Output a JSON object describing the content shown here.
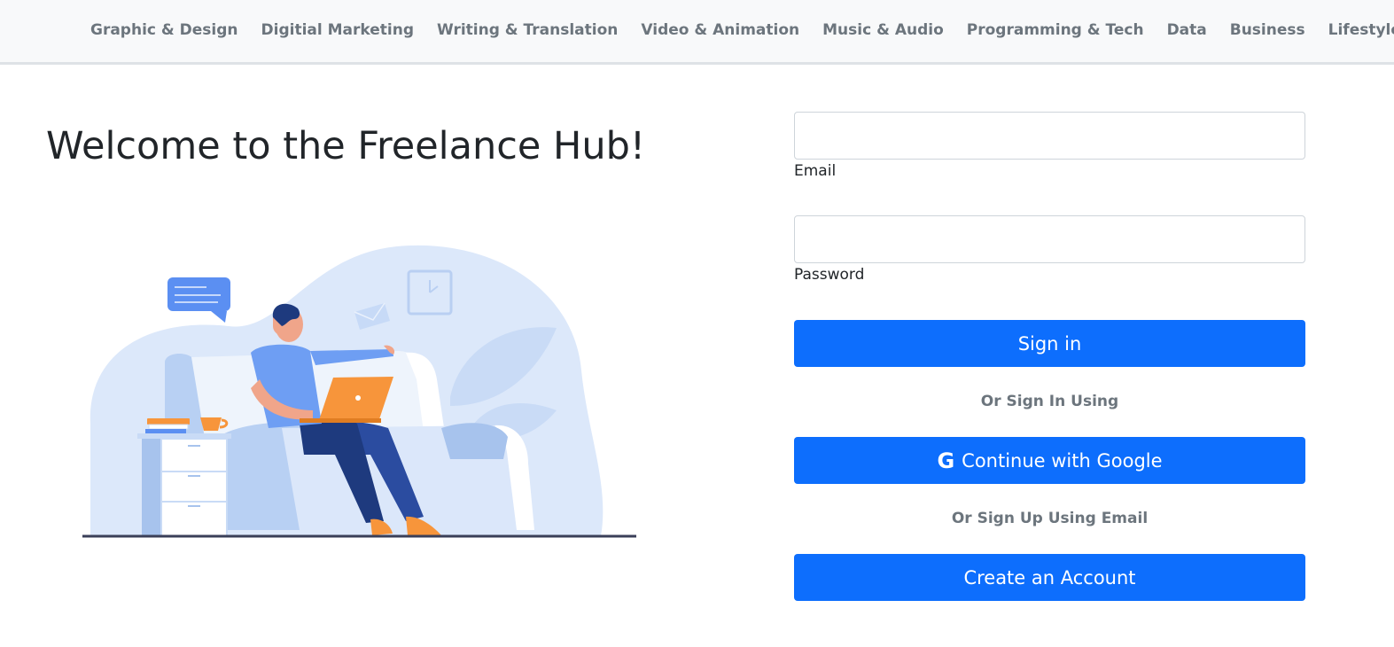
{
  "nav": {
    "items": [
      {
        "label": "Graphic & Design"
      },
      {
        "label": "Digitial Marketing"
      },
      {
        "label": "Writing & Translation"
      },
      {
        "label": "Video & Animation"
      },
      {
        "label": "Music & Audio"
      },
      {
        "label": "Programming & Tech"
      },
      {
        "label": "Data"
      },
      {
        "label": "Business"
      },
      {
        "label": "Lifestyle"
      }
    ]
  },
  "hero": {
    "title": "Welcome to the Freelance Hub!",
    "illustration_icon": "person-on-couch-with-laptop-illustration"
  },
  "login": {
    "email_label": "Email",
    "email_value": "",
    "password_label": "Password",
    "password_value": "",
    "signin_label": "Sign in",
    "or_signin_text": "Or Sign In Using",
    "google_icon": "G",
    "google_label": "Continue with Google",
    "or_signup_text": "Or Sign Up Using Email",
    "create_label": "Create an Account"
  },
  "colors": {
    "primary": "#0d6efd",
    "nav_bg": "#f8f9fa",
    "nav_text": "#6c757d",
    "illustration_blue": "#dce8fa",
    "illustration_orange": "#f7953b"
  }
}
